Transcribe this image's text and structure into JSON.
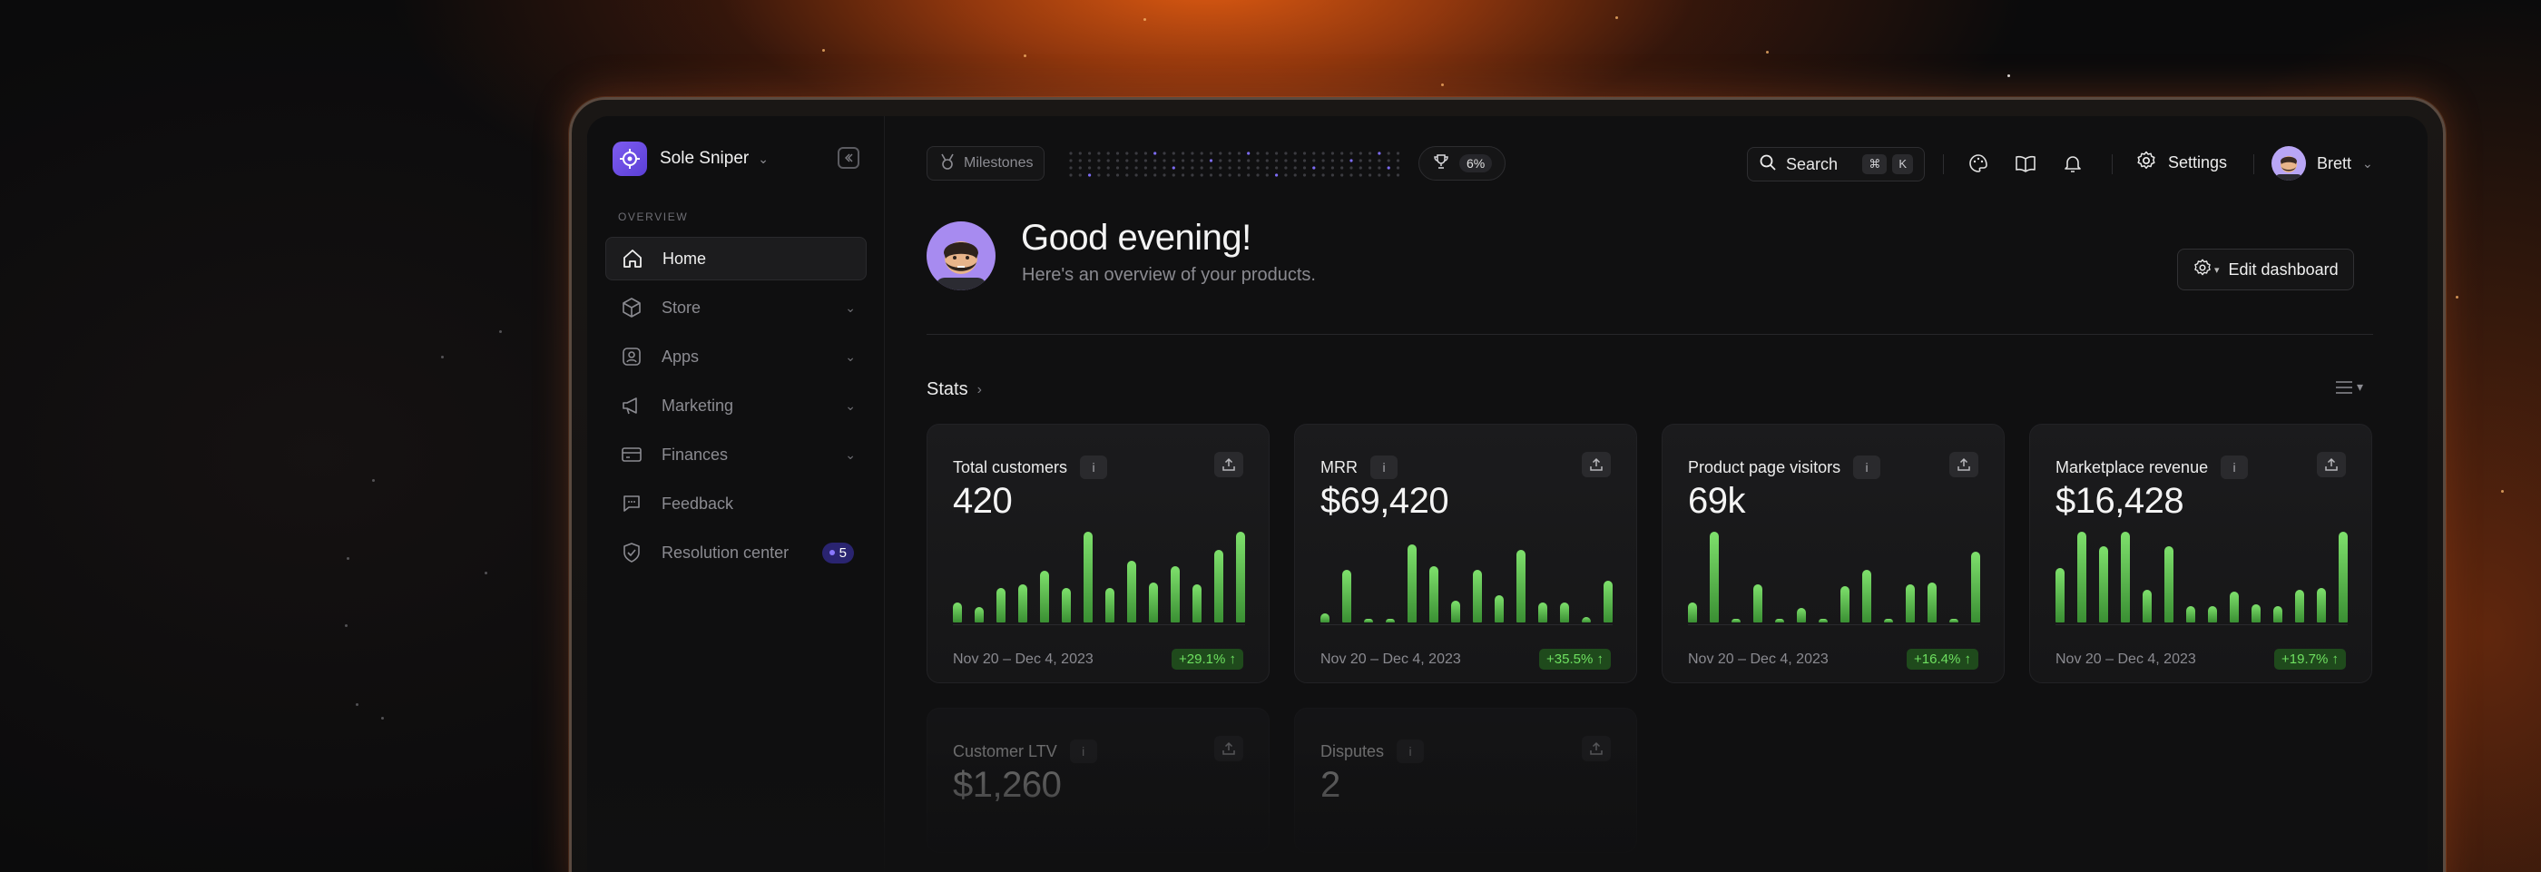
{
  "app": {
    "name": "Sole Sniper",
    "section": "OVERVIEW"
  },
  "sidebar": {
    "items": [
      {
        "label": "Home",
        "icon": "home-icon",
        "active": true
      },
      {
        "label": "Store",
        "icon": "box-icon",
        "expandable": true
      },
      {
        "label": "Apps",
        "icon": "apps-icon",
        "expandable": true
      },
      {
        "label": "Marketing",
        "icon": "megaphone-icon",
        "expandable": true
      },
      {
        "label": "Finances",
        "icon": "card-icon",
        "expandable": true
      },
      {
        "label": "Feedback",
        "icon": "chat-icon"
      },
      {
        "label": "Resolution center",
        "icon": "shield-icon",
        "badge": "5"
      }
    ]
  },
  "topbar": {
    "milestones_label": "Milestones",
    "progress": "6%",
    "search_label": "Search",
    "search_kbd": [
      "⌘",
      "K"
    ],
    "settings_label": "Settings",
    "user_name": "Brett"
  },
  "header": {
    "greeting": "Good evening!",
    "subtitle": "Here's an overview of your products.",
    "edit_button": "Edit dashboard"
  },
  "stats": {
    "title": "Stats",
    "cards": [
      {
        "title": "Total customers",
        "value": "420",
        "range": "Nov 20 – Dec 4, 2023",
        "delta": "+29.1%",
        "bars": [
          0.22,
          0.17,
          0.38,
          0.42,
          0.57,
          0.38,
          1.0,
          0.38,
          0.68,
          0.44,
          0.62,
          0.42,
          0.8,
          1.0
        ]
      },
      {
        "title": "MRR",
        "value": "$69,420",
        "range": "Nov 20 – Dec 4, 2023",
        "delta": "+35.5%",
        "bars": [
          0.1,
          0.58,
          0.04,
          0.04,
          0.86,
          0.62,
          0.24,
          0.58,
          0.3,
          0.8,
          0.22,
          0.22,
          0.06,
          0.46
        ]
      },
      {
        "title": "Product page visitors",
        "value": "69k",
        "range": "Nov 20 – Dec 4, 2023",
        "delta": "+16.4%",
        "bars": [
          0.22,
          1.0,
          0.04,
          0.42,
          0.04,
          0.16,
          0.04,
          0.4,
          0.58,
          0.04,
          0.42,
          0.44,
          0.04,
          0.78
        ]
      },
      {
        "title": "Marketplace revenue",
        "value": "$16,428",
        "range": "Nov 20 – Dec 4, 2023",
        "delta": "+19.7%",
        "bars": [
          0.6,
          1.0,
          0.84,
          1.0,
          0.36,
          0.84,
          0.18,
          0.18,
          0.34,
          0.2,
          0.18,
          0.36,
          0.38,
          1.0
        ]
      },
      {
        "title": "Customer LTV",
        "value": "$1,260"
      },
      {
        "title": "Disputes",
        "value": "2"
      }
    ]
  },
  "colors": {
    "accent": "#7d5cf0",
    "positive": "#6ee060",
    "glow": "#e85e12"
  }
}
